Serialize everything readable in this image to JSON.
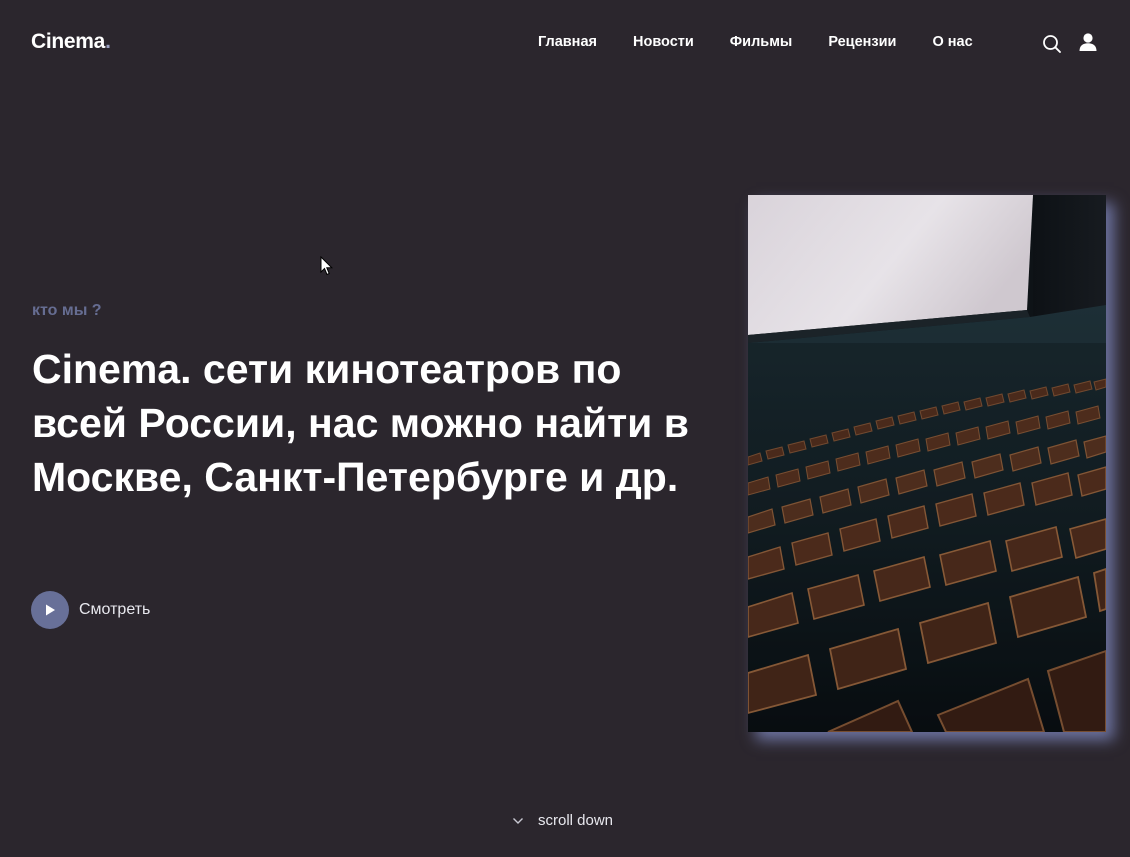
{
  "header": {
    "logo_text": "Cinema",
    "logo_dot": ".",
    "nav": [
      {
        "label": "Главная"
      },
      {
        "label": "Новости"
      },
      {
        "label": "Фильмы"
      },
      {
        "label": "Рецензии"
      },
      {
        "label": "О нас"
      }
    ],
    "icons": {
      "search": "search-icon",
      "user": "user-icon"
    }
  },
  "hero": {
    "eyebrow": "кто мы ?",
    "headline": "Cinema. сети кинотеатров по всей России, нас можно найти в Москве, Санкт-Петербурге и др.",
    "watch_label": "Смотреть"
  },
  "footer": {
    "scroll_label": "scroll down"
  },
  "colors": {
    "background": "#2b262d",
    "accent": "#687098",
    "eyebrow": "#666d92"
  }
}
